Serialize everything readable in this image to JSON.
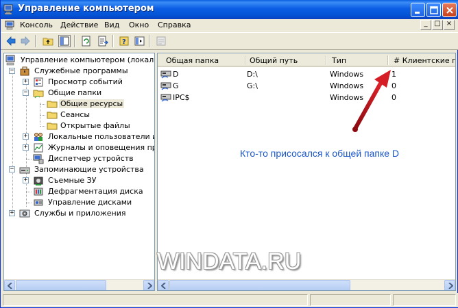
{
  "window": {
    "title": "Управление компьютером"
  },
  "menu": {
    "items": [
      "Консоль",
      "Действие",
      "Вид",
      "Окно",
      "Справка"
    ],
    "mdi": [
      "_",
      "□",
      "×"
    ]
  },
  "tree": {
    "root": "Управление компьютером (локальный)",
    "nodes": [
      {
        "label": "Служебные программы",
        "expander": "−"
      },
      {
        "label": "Просмотр событий",
        "expander": "+"
      },
      {
        "label": "Общие папки",
        "expander": "−"
      },
      {
        "label": "Общие ресурсы"
      },
      {
        "label": "Сеансы"
      },
      {
        "label": "Открытые файлы"
      },
      {
        "label": "Локальные пользователи и гр",
        "expander": "+"
      },
      {
        "label": "Журналы и оповещения произ",
        "expander": "+"
      },
      {
        "label": "Диспетчер устройств"
      },
      {
        "label": "Запоминающие устройства",
        "expander": "−"
      },
      {
        "label": "Съемные ЗУ",
        "expander": "+"
      },
      {
        "label": "Дефрагментация диска"
      },
      {
        "label": "Управление дисками"
      },
      {
        "label": "Службы и приложения",
        "expander": "+"
      }
    ]
  },
  "list": {
    "columns": [
      "Общая папка",
      "Общий путь",
      "Тип",
      "# Клиентские под"
    ],
    "rows": [
      {
        "share": "D",
        "path": "D:\\",
        "type": "Windows",
        "clients": "1"
      },
      {
        "share": "G",
        "path": "G:\\",
        "type": "Windows",
        "clients": "0"
      },
      {
        "share": "IPC$",
        "path": "",
        "type": "Windows",
        "clients": "0"
      }
    ]
  },
  "annotation": "Кто-то присосался к общей папке D",
  "watermark": "WINDATA.RU",
  "colors": {
    "titlebar": "#0b5de4",
    "annotation_text": "#1a55c8",
    "arrow": "#c8141e",
    "window_bg": "#ece9d8"
  }
}
